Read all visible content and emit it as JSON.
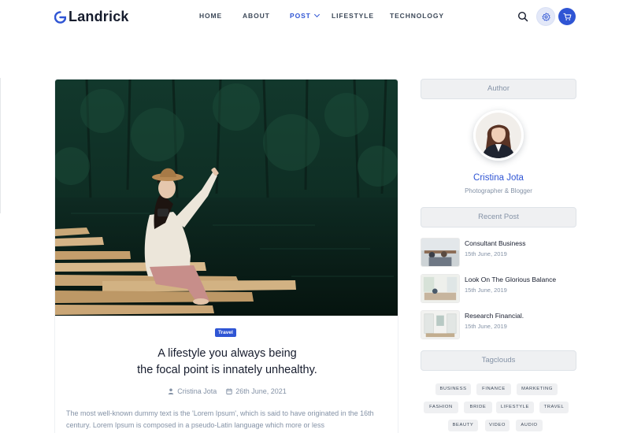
{
  "brand": {
    "name": "Landrick",
    "accent": "#2f55d4"
  },
  "nav": {
    "items": [
      {
        "label": "HOME",
        "active": false
      },
      {
        "label": "ABOUT",
        "active": false
      },
      {
        "label": "POST",
        "active": true
      },
      {
        "label": "LIFESTYLE",
        "active": false
      },
      {
        "label": "TECHNOLOGY",
        "active": false
      }
    ],
    "icons": [
      "search-icon",
      "gear-icon",
      "cart-icon"
    ]
  },
  "post": {
    "badge": "Travel",
    "title_line1": "A lifestyle you always being",
    "title_line2": "the focal point is innately unhealthy.",
    "author": "Cristina Jota",
    "date": "26th June, 2021",
    "excerpt": "The most well-known dummy text is the 'Lorem Ipsum', which is said to have originated in the 16th century. Lorem Ipsum is composed in a pseudo-Latin language which more or less"
  },
  "sidebar": {
    "author_heading": "Author",
    "author_name": "Cristina Jota",
    "author_role": "Photographer & Blogger",
    "recent_heading": "Recent Post",
    "recent": [
      {
        "title": "Consultant Business",
        "date": "15th June, 2019"
      },
      {
        "title": "Look On The Glorious Balance",
        "date": "15th June, 2019"
      },
      {
        "title": "Research Financial.",
        "date": "15th June, 2019"
      }
    ],
    "tags_heading": "Tagclouds",
    "tags": [
      "BUSINESS",
      "FINANCE",
      "MARKETING",
      "FASHION",
      "BRIDE",
      "LIFESTYLE",
      "TRAVEL",
      "BEAUTY",
      "VIDEO",
      "AUDIO"
    ]
  }
}
